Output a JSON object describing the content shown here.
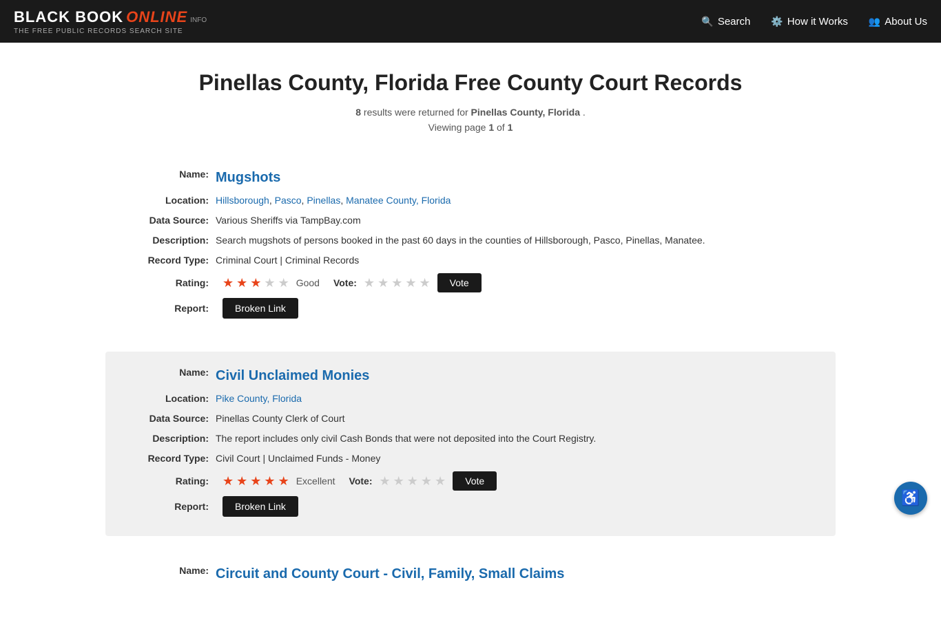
{
  "header": {
    "logo_black": "BLACK BOOK",
    "logo_online": "ONLINE",
    "logo_info": "INFO",
    "logo_sub": "THE FREE PUBLIC RECORDS SEARCH SITE",
    "nav": [
      {
        "label": "Search",
        "icon": "🔍",
        "name": "nav-search"
      },
      {
        "label": "How it Works",
        "icon": "⚙️",
        "name": "nav-how-it-works"
      },
      {
        "label": "About Us",
        "icon": "👥",
        "name": "nav-about-us"
      }
    ]
  },
  "page": {
    "title": "Pinellas County, Florida Free County Court Records",
    "results_count": "8",
    "results_location": "Pinellas County, Florida",
    "current_page": "1",
    "total_pages": "1"
  },
  "records": [
    {
      "id": "mugshots",
      "name": "Mugshots",
      "location_parts": [
        "Hillsborough",
        "Pasco",
        "Pinellas",
        "Manatee County, Florida"
      ],
      "data_source": "Various Sheriffs via TampBay.com",
      "description": "Search mugshots of persons booked in the past 60 days in the counties of Hillsborough, Pasco, Pinellas, Manatee.",
      "record_type": "Criminal Court | Criminal Records",
      "rating_stars": 3,
      "rating_text": "Good",
      "vote_stars": 0,
      "shaded": false
    },
    {
      "id": "civil-unclaimed-monies",
      "name": "Civil Unclaimed Monies",
      "location_parts": [
        "Pike County, Florida"
      ],
      "data_source": "Pinellas County Clerk of Court",
      "description": "The report includes only civil Cash Bonds that were not deposited into the Court Registry.",
      "record_type": "Civil Court | Unclaimed Funds - Money",
      "rating_stars": 5,
      "rating_text": "Excellent",
      "vote_stars": 0,
      "shaded": true
    },
    {
      "id": "circuit-and-county-court",
      "name": "Circuit and County Court - Civil, Family, Small Claims",
      "shaded": false,
      "partial": true
    }
  ],
  "labels": {
    "name": "Name:",
    "location": "Location:",
    "data_source": "Data Source:",
    "description": "Description:",
    "record_type": "Record Type:",
    "rating": "Rating:",
    "report": "Report:",
    "vote": "Vote:",
    "vote_button": "Vote",
    "broken_link_button": "Broken Link"
  }
}
